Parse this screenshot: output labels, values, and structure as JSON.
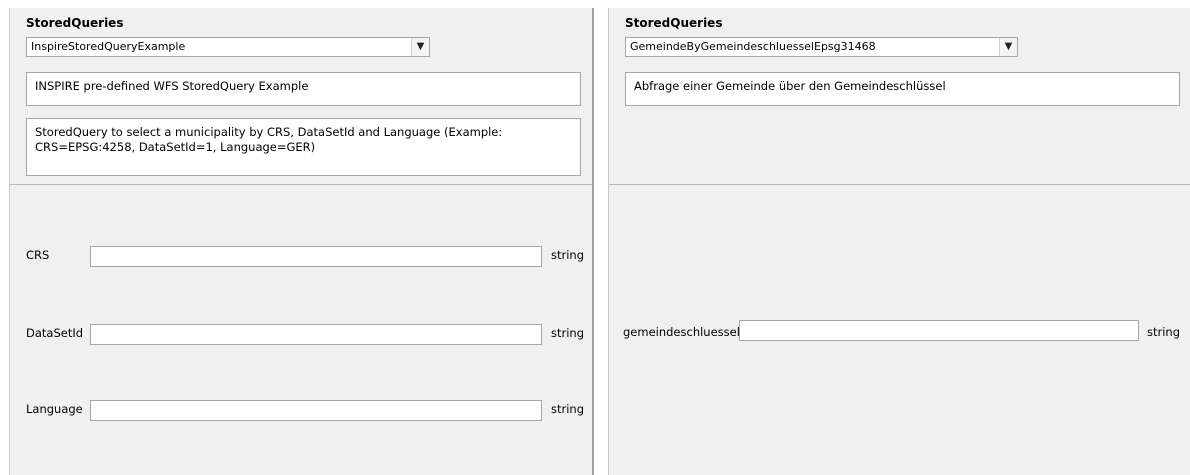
{
  "left_panel": {
    "title": "StoredQueries",
    "selected_query": "InspireStoredQueryExample",
    "query_title": "INSPIRE pre-defined WFS StoredQuery Example",
    "query_abstract": "StoredQuery to select a municipality by CRS, DataSetId and Language (Example: CRS=EPSG:4258, DataSetId=1, Language=GER)",
    "parameters": [
      {
        "name": "CRS",
        "value": "",
        "type": "string"
      },
      {
        "name": "DataSetId",
        "value": "",
        "type": "string"
      },
      {
        "name": "Language",
        "value": "",
        "type": "string"
      }
    ]
  },
  "right_panel": {
    "title": "StoredQueries",
    "selected_query": "GemeindeByGemeindeschluesselEpsg31468",
    "query_title": "Abfrage einer Gemeinde über den Gemeindeschlüssel",
    "query_abstract": "",
    "parameters": [
      {
        "name": "gemeindeschluessel",
        "value": "",
        "type": "string"
      }
    ]
  },
  "icons": {
    "dropdown": "chevron-down-icon"
  }
}
